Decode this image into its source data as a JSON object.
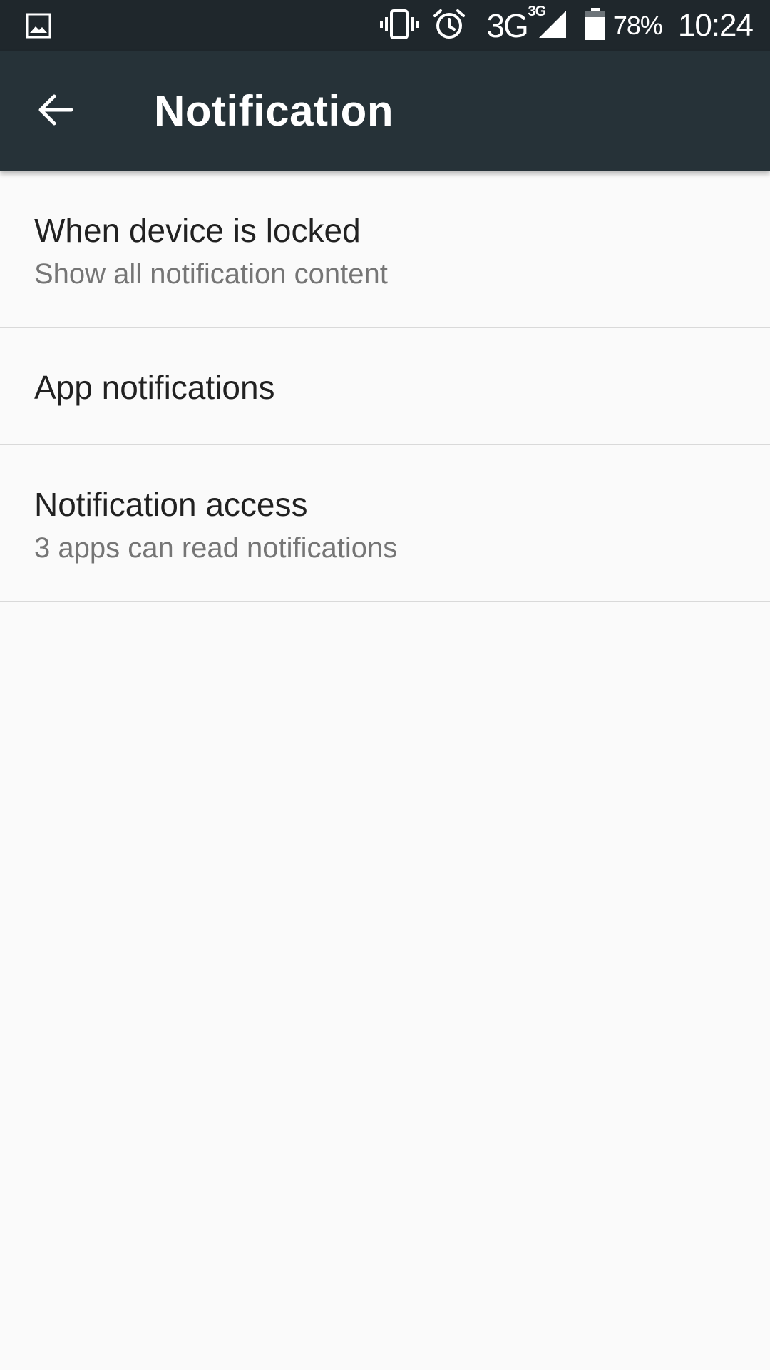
{
  "status_bar": {
    "left_icon": "image-notification-icon",
    "icons": [
      "vibrate-icon",
      "alarm-icon",
      "signal-icon",
      "battery-icon"
    ],
    "network_type": "3G",
    "network_sub": "3G",
    "battery_percent": "78%",
    "time": "10:24",
    "background": "#1f272c"
  },
  "app_bar": {
    "back_icon": "arrow-back-icon",
    "title": "Notification",
    "background": "#263238"
  },
  "settings": {
    "items": [
      {
        "title": "When device is locked",
        "summary": "Show all notification content"
      },
      {
        "title": "App notifications"
      },
      {
        "title": "Notification access",
        "summary": "3 apps can read notifications"
      }
    ]
  },
  "colors": {
    "background": "#fafafa",
    "title_text": "#212121",
    "summary_text": "#757575",
    "divider": "#d9d9d9"
  }
}
